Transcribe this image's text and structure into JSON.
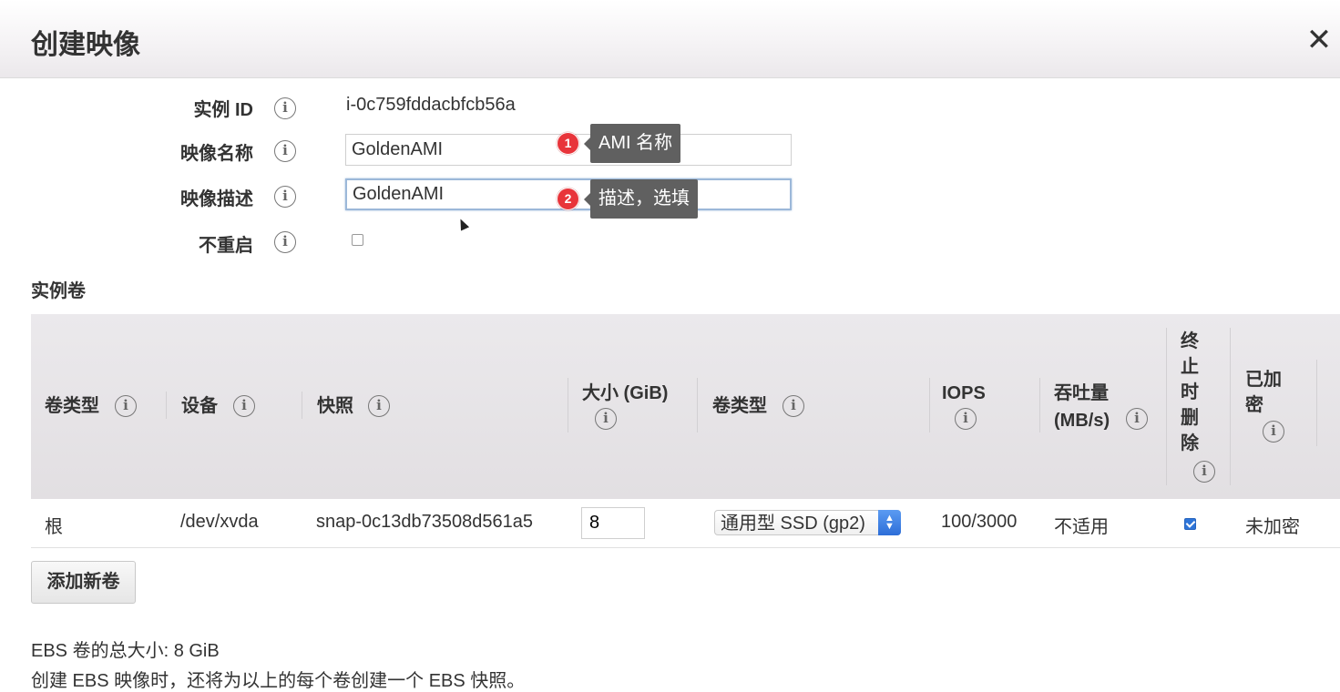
{
  "dialog": {
    "title": "创建映像",
    "close_label": "✕"
  },
  "form": {
    "instance_id": {
      "label": "实例 ID",
      "value": "i-0c759fddacbfcb56a"
    },
    "image_name": {
      "label": "映像名称",
      "value": "GoldenAMI"
    },
    "image_description": {
      "label": "映像描述",
      "value": "GoldenAMI"
    },
    "no_reboot": {
      "label": "不重启",
      "checked": false
    }
  },
  "annotations": [
    {
      "number": "1",
      "text": "AMI 名称"
    },
    {
      "number": "2",
      "text": "描述，选填"
    }
  ],
  "volumes": {
    "section_title": "实例卷",
    "headers": {
      "volume_type": "卷类型",
      "device": "设备",
      "snapshot": "快照",
      "size_line1": "大小 (GiB)",
      "ebs_volume_type": "卷类型",
      "iops": "IOPS",
      "throughput_line1": "吞吐量",
      "throughput_line2": "(MB/s)",
      "delete_on_termination": [
        "终",
        "止",
        "时",
        "删",
        "除"
      ],
      "encrypted_line1": "已加",
      "encrypted_line2": "密"
    },
    "rows": [
      {
        "volume_type": "根",
        "device": "/dev/xvda",
        "snapshot": "snap-0c13db73508d561a5",
        "size": "8",
        "ebs_volume_type": "通用型 SSD (gp2)",
        "iops": "100/3000",
        "throughput": "不适用",
        "delete_on_termination": true,
        "encrypted": "未加密"
      }
    ],
    "add_button": "添加新卷"
  },
  "footer": {
    "total_size": "EBS 卷的总大小: 8 GiB",
    "note": "创建 EBS 映像时，还将为以上的每个卷创建一个 EBS 快照。"
  },
  "icons": {
    "info": "i",
    "select_arrows": "▲▼"
  },
  "colors": {
    "tooltip_bg": "#606060",
    "badge_red": "#e8343a",
    "focus_border": "#9cb8d9",
    "checkbox_blue": "#2d74d8"
  }
}
